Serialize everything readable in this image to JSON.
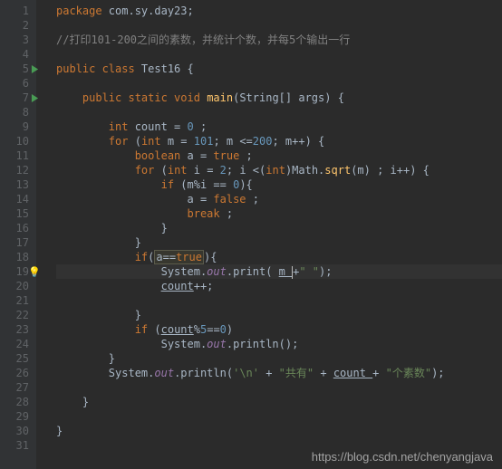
{
  "gutter": [
    "1",
    "2",
    "3",
    "4",
    "5",
    "6",
    "7",
    "8",
    "9",
    "10",
    "11",
    "12",
    "13",
    "14",
    "15",
    "16",
    "17",
    "18",
    "19",
    "20",
    "21",
    "22",
    "23",
    "24",
    "25",
    "26",
    "27",
    "28",
    "29",
    "30",
    "31"
  ],
  "code": {
    "l1": {
      "kw0": "package ",
      "pkg": "com.sy.day23",
      "sc": ";"
    },
    "l3": {
      "cmt": "//打印101-200之间的素数，并统计个数，并每5个输出一行"
    },
    "l5": {
      "kw0": "public class ",
      "cls": "Test16 ",
      "br": "{"
    },
    "l7": {
      "kw0": "public static void ",
      "m": "main",
      "p": "(String[] args) ",
      "br": "{"
    },
    "l9": {
      "kw0": "int ",
      "v": "count = ",
      "n": "0 ",
      "sc": ";"
    },
    "l10": {
      "kw0": "for ",
      "p0": "(",
      "kw1": "int ",
      "v": "m = ",
      "n0": "101",
      "s0": "; m <=",
      "n1": "200",
      "s1": "; m++) {"
    },
    "l11": {
      "kw0": "boolean ",
      "v": "a = ",
      "kw1": "true ",
      "sc": ";"
    },
    "l12": {
      "kw0": "for ",
      "p0": "(",
      "kw1": "int ",
      "v": "i = ",
      "n0": "2",
      "s0": "; i <(",
      "kw2": "int",
      "s1": ")Math.",
      "m": "sqrt",
      "s2": "(m) ; i++) {"
    },
    "l13": {
      "kw0": "if ",
      "s0": "(m%i == ",
      "n": "0",
      "s1": "){"
    },
    "l14": {
      "s0": "a = ",
      "kw0": "false ",
      "sc": ";"
    },
    "l15": {
      "kw0": "break ",
      "sc": ";"
    },
    "l16": {
      "br": "}"
    },
    "l17": {
      "br": "}"
    },
    "l18": {
      "kw0": "if",
      "s0": "(",
      "box": "a==",
      "kw1": "true",
      "s1": "){"
    },
    "l19": {
      "s0": "System.",
      "f": "out",
      "s1": ".print( ",
      "u": "m ",
      "s2": "+",
      "str": "\" \"",
      "s3": ");"
    },
    "l20": {
      "u": "count",
      "s0": "++;"
    },
    "l22": {
      "br": "}"
    },
    "l23": {
      "kw0": "if ",
      "s0": "(",
      "u": "count",
      "s1": "%",
      "n": "5",
      "s2": "==",
      "n1": "0",
      "s3": ")"
    },
    "l24": {
      "s0": "System.",
      "f": "out",
      "s1": ".println();"
    },
    "l25": {
      "br": "}"
    },
    "l26": {
      "s0": "System.",
      "f": "out",
      "s1": ".println(",
      "str0": "'\\n' ",
      "s2": "+ ",
      "str1": "\"共有\" ",
      "s3": "+ ",
      "u": "count ",
      "s4": "+ ",
      "str2": "\"个素数\"",
      "s5": ");"
    },
    "l28": {
      "br": "}"
    },
    "l30": {
      "br": "}"
    }
  },
  "watermark": "https://blog.csdn.net/chenyangjava"
}
